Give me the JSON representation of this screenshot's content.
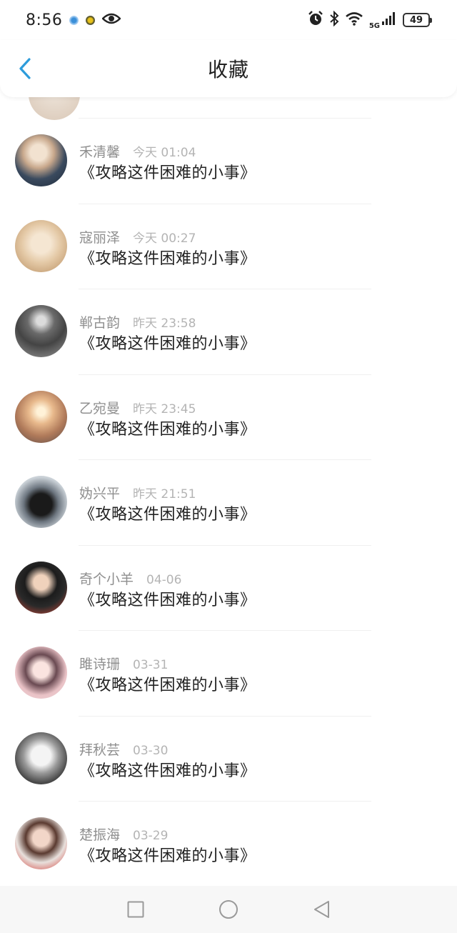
{
  "status_bar": {
    "time": "8:56",
    "network": "5G",
    "battery": "49",
    "icons": [
      "app-notification-icon",
      "app-notification-icon-2",
      "eye-icon",
      "alarm-icon",
      "bluetooth-icon",
      "wifi-icon",
      "signal-icon",
      "battery-icon"
    ]
  },
  "header": {
    "title": "收藏",
    "back_icon": "chevron-left-icon",
    "accent_color": "#2d9cdb"
  },
  "favorites": [
    {
      "name": "禾清馨",
      "time": "今天 01:04",
      "text": "《攻略这件困难的小事》"
    },
    {
      "name": "寇丽泽",
      "time": "今天 00:27",
      "text": "《攻略这件困难的小事》"
    },
    {
      "name": "郸古韵",
      "time": "昨天 23:58",
      "text": "《攻略这件困难的小事》"
    },
    {
      "name": "乙宛曼",
      "time": "昨天 23:45",
      "text": "《攻略这件困难的小事》"
    },
    {
      "name": "妫兴平",
      "time": "昨天 21:51",
      "text": "《攻略这件困难的小事》"
    },
    {
      "name": "奇个小羊",
      "time": "04-06",
      "text": "《攻略这件困难的小事》"
    },
    {
      "name": "雎诗珊",
      "time": "03-31",
      "text": "《攻略这件困难的小事》"
    },
    {
      "name": "拜秋芸",
      "time": "03-30",
      "text": "《攻略这件困难的小事》"
    },
    {
      "name": "楚振海",
      "time": "03-29",
      "text": "《攻略这件困难的小事》"
    }
  ],
  "nav_bar": {
    "icons": [
      "recent-apps-icon",
      "home-icon",
      "back-icon"
    ]
  }
}
